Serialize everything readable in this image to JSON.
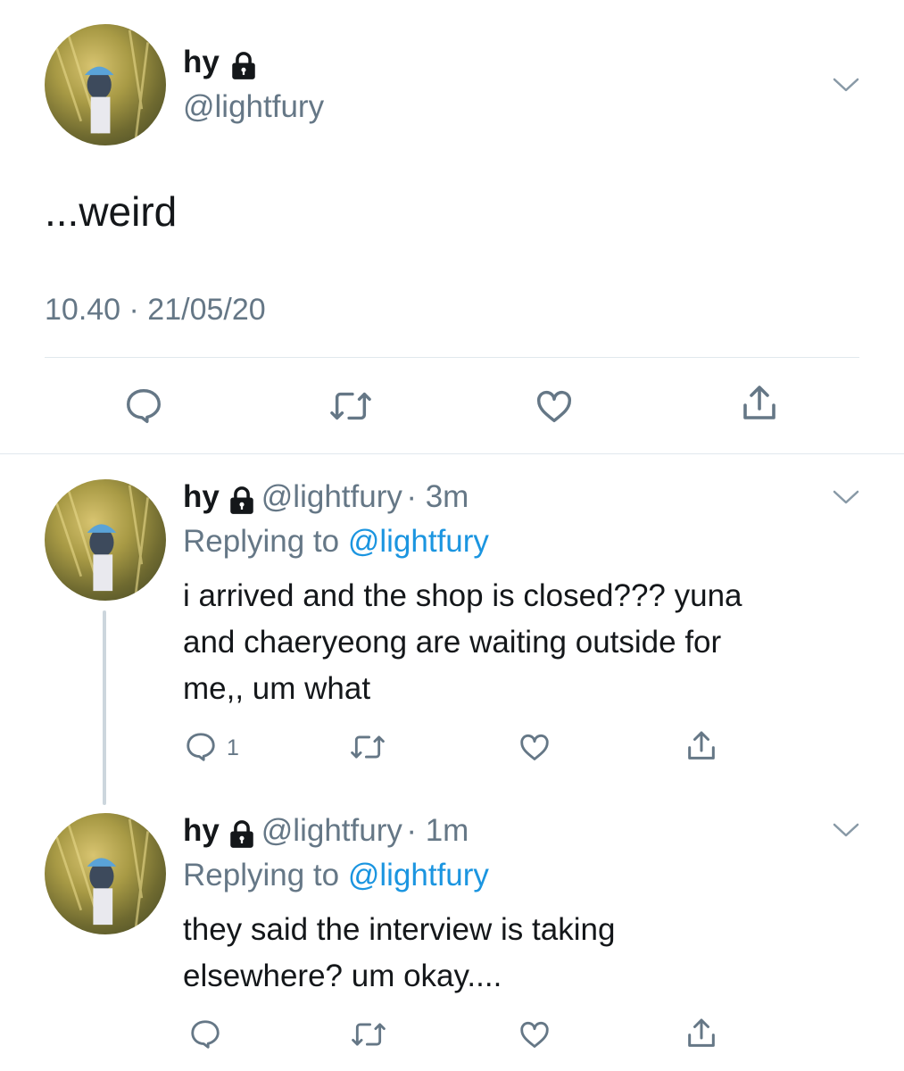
{
  "main_tweet": {
    "name": "hy",
    "handle": "@lightfury",
    "text": "...weird",
    "timestamp": "10.40 · 21/05/20",
    "icons": [
      "reply-icon",
      "retweet-icon",
      "like-icon",
      "share-icon"
    ]
  },
  "replies": [
    {
      "name": "hy",
      "handle": "@lightfury",
      "time": "· 3m",
      "replying_prefix": "Replying to",
      "replying_to": "@lightfury",
      "text_lines": [
        "i arrived and the shop is closed??? yuna",
        "and chaeryeong are waiting outside for",
        "me,, um what"
      ],
      "reply_count": "1"
    },
    {
      "name": "hy",
      "handle": "@lightfury",
      "time": "· 1m",
      "replying_prefix": "Replying to",
      "replying_to": "@lightfury",
      "text_lines": [
        "they said the interview is taking",
        "elsewhere? um okay...."
      ],
      "reply_count": ""
    }
  ],
  "colors": {
    "accent": "#1b95e0",
    "secondary_text": "#657786",
    "divider": "#e1e8ed"
  }
}
